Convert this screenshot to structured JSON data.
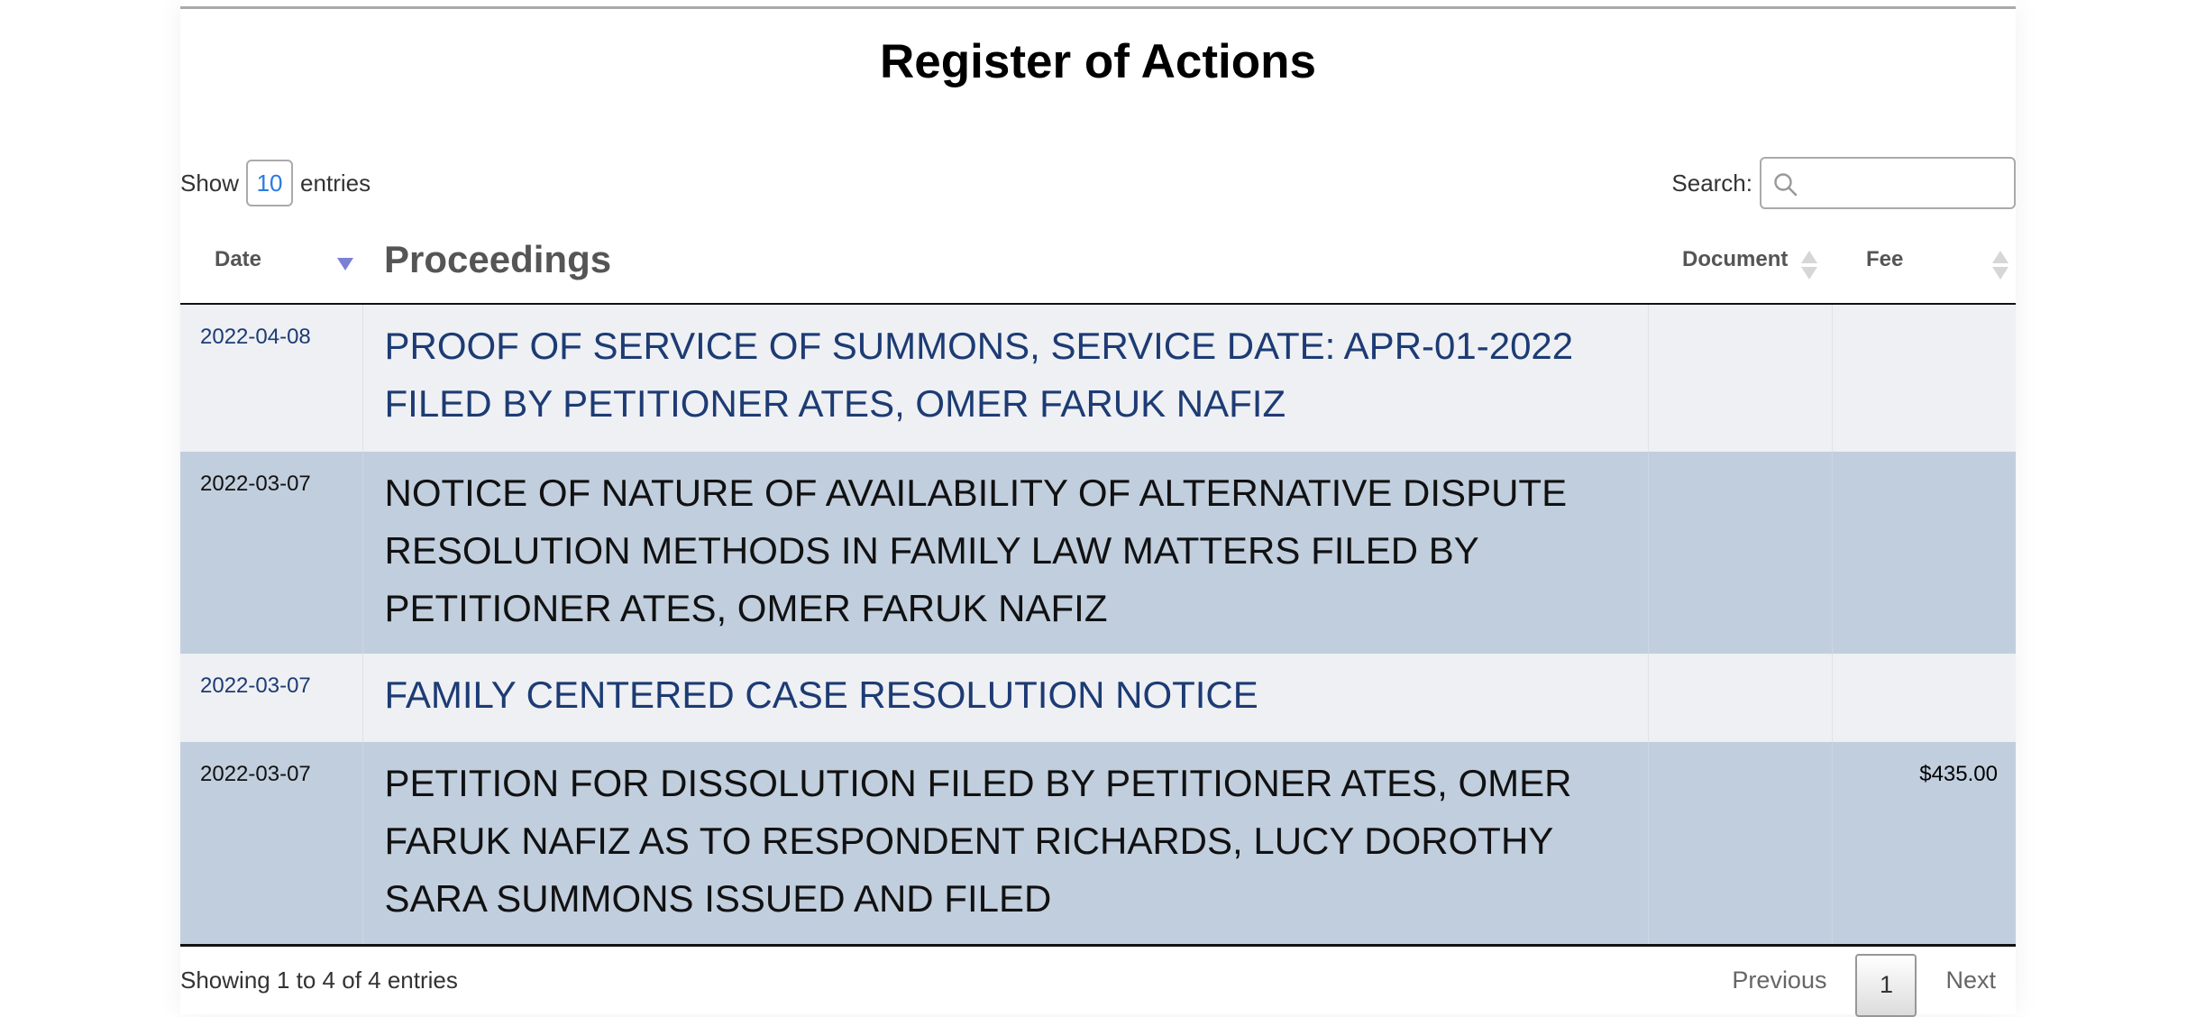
{
  "page": {
    "title": "Register of Actions"
  },
  "controls": {
    "show_label": "Show",
    "entries_label": "entries",
    "page_length": "10",
    "search_label": "Search:",
    "search_value": "",
    "search_icon": "search-icon"
  },
  "table": {
    "columns": [
      {
        "label": "Date",
        "sort": "descending"
      },
      {
        "label": "Proceedings",
        "sort": "none"
      },
      {
        "label": "Document",
        "sort": "sortable"
      },
      {
        "label": "Fee",
        "sort": "sortable"
      }
    ],
    "rows": [
      {
        "date": "2022-04-08",
        "proceedings": "PROOF OF SERVICE OF SUMMONS, SERVICE DATE: APR-01-2022 FILED BY PETITIONER ATES, OMER FARUK NAFIZ",
        "document": "",
        "fee": ""
      },
      {
        "date": "2022-03-07",
        "proceedings": "NOTICE OF NATURE OF AVAILABILITY OF ALTERNATIVE DISPUTE RESOLUTION METHODS IN FAMILY LAW MATTERS FILED BY PETITIONER ATES, OMER FARUK NAFIZ",
        "document": "",
        "fee": ""
      },
      {
        "date": "2022-03-07",
        "proceedings": "FAMILY CENTERED CASE RESOLUTION NOTICE",
        "document": "",
        "fee": ""
      },
      {
        "date": "2022-03-07",
        "proceedings": "PETITION FOR DISSOLUTION FILED BY PETITIONER ATES, OMER FARUK NAFIZ AS TO RESPONDENT RICHARDS, LUCY DOROTHY SARA SUMMONS ISSUED AND FILED",
        "document": "",
        "fee": "$435.00"
      }
    ]
  },
  "footer": {
    "info": "Showing 1 to 4 of 4 entries",
    "previous_label": "Previous",
    "current_page": "1",
    "next_label": "Next"
  },
  "colors": {
    "link_navy": "#1d3b74",
    "row_light": "#eef0f3",
    "row_blue": "#c1cede",
    "sort_active": "#7b7fd6",
    "page_length_blue": "#2a7ae2"
  }
}
